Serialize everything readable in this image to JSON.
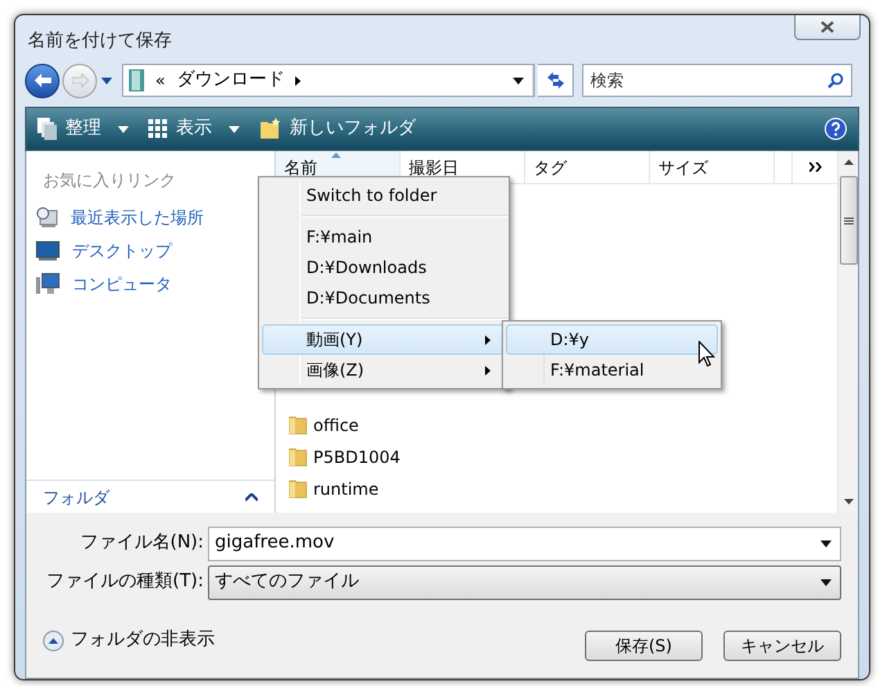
{
  "window": {
    "title": "名前を付けて保存"
  },
  "address_bar": {
    "prefix": "«",
    "location": "ダウンロード"
  },
  "search": {
    "placeholder": "検索"
  },
  "toolbar": {
    "items": [
      {
        "kind": "menu",
        "label": "整理"
      },
      {
        "kind": "menu",
        "label": "表示"
      },
      {
        "kind": "button",
        "label": "新しいフォルダ"
      }
    ]
  },
  "favorite_links": {
    "title": "お気に入りリンク",
    "items": [
      {
        "kind": "recent",
        "label": "最近表示した場所"
      },
      {
        "kind": "desktop",
        "label": "デスクトップ"
      },
      {
        "kind": "computer",
        "label": "コンピュータ"
      }
    ]
  },
  "folders_header": {
    "label": "フォルダ"
  },
  "columns": [
    {
      "label": "名前",
      "sorted": true
    },
    {
      "label": "撮影日",
      "sorted": false
    },
    {
      "label": "タグ",
      "sorted": false
    },
    {
      "label": "サイズ",
      "sorted": false
    }
  ],
  "files": [
    {
      "name": "office"
    },
    {
      "name": "P5BD1004"
    },
    {
      "name": "runtime"
    }
  ],
  "context_menu": {
    "items": [
      {
        "kind": "item",
        "label": "Switch to folder",
        "selected": false
      },
      {
        "kind": "separator"
      },
      {
        "kind": "item",
        "label": "F:¥main",
        "selected": false
      },
      {
        "kind": "item",
        "label": "D:¥Downloads",
        "selected": false
      },
      {
        "kind": "item",
        "label": "D:¥Documents",
        "selected": false
      },
      {
        "kind": "separator"
      },
      {
        "kind": "submenu",
        "label": "動画(Y)",
        "selected": true
      },
      {
        "kind": "submenu",
        "label": "画像(Z)",
        "selected": false
      }
    ]
  },
  "submenu": {
    "items": [
      {
        "label": "D:¥y",
        "selected": true
      },
      {
        "label": "F:¥material",
        "selected": false
      }
    ]
  },
  "file_name": {
    "label": "ファイル名(N):",
    "value": "gigafree.mov"
  },
  "file_type": {
    "label": "ファイルの種類(T):",
    "value": "すべてのファイル"
  },
  "hide_folders": {
    "label": "フォルダの非表示"
  },
  "buttons": [
    {
      "label": "保存(S)"
    },
    {
      "label": "キャンセル"
    }
  ]
}
